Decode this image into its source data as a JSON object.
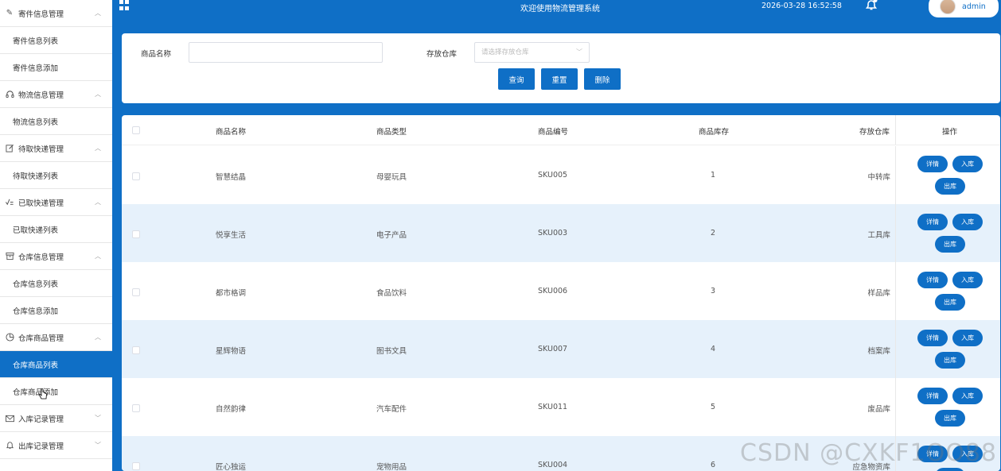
{
  "sidebar": {
    "groups": [
      {
        "label": "寄件信息管理",
        "icon": "pen-icon",
        "children": [
          "寄件信息列表",
          "寄件信息添加"
        ]
      },
      {
        "label": "物流信息管理",
        "icon": "headset-icon",
        "children": [
          "物流信息列表"
        ]
      },
      {
        "label": "待取快递管理",
        "icon": "edit-icon",
        "children": [
          "待取快递列表"
        ]
      },
      {
        "label": "已取快递管理",
        "icon": "check-list-icon",
        "children": [
          "已取快递列表"
        ]
      },
      {
        "label": "仓库信息管理",
        "icon": "box-icon",
        "children": [
          "仓库信息列表",
          "仓库信息添加"
        ]
      },
      {
        "label": "仓库商品管理",
        "icon": "pie-chart-icon",
        "children": [
          "仓库商品列表",
          "仓库商品添加"
        ]
      },
      {
        "label": "入库记录管理",
        "icon": "mail-icon",
        "children": []
      },
      {
        "label": "出库记录管理",
        "icon": "bell-icon",
        "children": []
      }
    ],
    "active_item": "仓库商品列表"
  },
  "header": {
    "title": "欢迎使用物流管理系统",
    "datetime": "2026-03-28 16:52:58",
    "user": "admin"
  },
  "search": {
    "name_label": "商品名称",
    "name_value": "",
    "warehouse_label": "存放仓库",
    "warehouse_placeholder": "请选择存放仓库",
    "query_btn": "查询",
    "reset_btn": "重置",
    "delete_btn": "删除"
  },
  "table": {
    "headers": [
      "商品名称",
      "商品类型",
      "商品编号",
      "商品库存",
      "存放仓库",
      "操作"
    ],
    "rows": [
      {
        "name": "智慧结晶",
        "type": "母婴玩具",
        "code": "SKU005",
        "stock": "1",
        "warehouse": "中转库"
      },
      {
        "name": "悦享生活",
        "type": "电子产品",
        "code": "SKU003",
        "stock": "2",
        "warehouse": "工具库"
      },
      {
        "name": "都市格调",
        "type": "食品饮料",
        "code": "SKU006",
        "stock": "3",
        "warehouse": "样品库"
      },
      {
        "name": "星辉物语",
        "type": "图书文具",
        "code": "SKU007",
        "stock": "4",
        "warehouse": "档案库"
      },
      {
        "name": "自然韵律",
        "type": "汽车配件",
        "code": "SKU011",
        "stock": "5",
        "warehouse": "废品库"
      },
      {
        "name": "匠心独运",
        "type": "宠物用品",
        "code": "SKU004",
        "stock": "6",
        "warehouse": "应急物资库"
      }
    ],
    "actions": {
      "detail": "详情",
      "in": "入库",
      "out": "出库"
    }
  },
  "watermark": "CSDN @CXKF1OO88"
}
